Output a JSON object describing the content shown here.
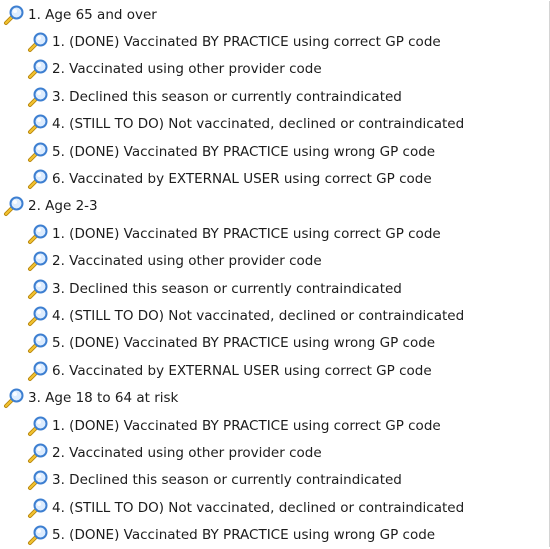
{
  "groups": [
    {
      "label": "1. Age 65 and over",
      "icon": "magnifier-icon",
      "children": [
        "1. (DONE) Vaccinated BY PRACTICE using correct GP code",
        "2. Vaccinated using other provider code",
        "3. Declined this season or currently contraindicated",
        "4. (STILL TO DO) Not vaccinated, declined or contraindicated",
        "5. (DONE) Vaccinated BY PRACTICE using wrong GP code",
        "6. Vaccinated by EXTERNAL USER using correct GP code"
      ]
    },
    {
      "label": "2. Age 2-3",
      "icon": "magnifier-icon",
      "children": [
        "1. (DONE) Vaccinated BY PRACTICE using correct GP code",
        "2. Vaccinated using other provider code",
        "3. Declined this season or currently contraindicated",
        "4. (STILL TO DO) Not vaccinated, declined or contraindicated",
        "5. (DONE) Vaccinated BY PRACTICE using wrong GP code",
        "6. Vaccinated by EXTERNAL USER using correct GP code"
      ]
    },
    {
      "label": "3. Age 18 to 64 at risk",
      "icon": "magnifier-icon",
      "children": [
        "1. (DONE) Vaccinated BY PRACTICE using correct GP code",
        "2. Vaccinated using other provider code",
        "3. Declined this season or currently contraindicated",
        "4. (STILL TO DO) Not vaccinated, declined or contraindicated",
        "5. (DONE) Vaccinated BY PRACTICE using wrong GP code"
      ]
    }
  ],
  "colors": {
    "text": "#1c1c1c",
    "icon_lens": "#3d7fd1",
    "icon_handle": "#d9a21b"
  }
}
